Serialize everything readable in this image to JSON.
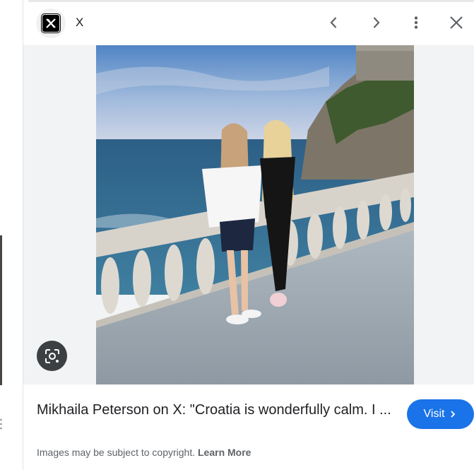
{
  "source": {
    "name": "X",
    "logo_letter": "X"
  },
  "icons": {
    "prev": "chevron-left-icon",
    "next": "chevron-right-icon",
    "more": "more-vert-icon",
    "close": "close-icon",
    "lens": "google-lens-icon"
  },
  "result": {
    "title": "Mikhaila Peterson on X: \"Croatia is wonderfully calm. I ...",
    "visit_label": "Visit"
  },
  "footer": {
    "copyright_text": "Images may be subject to copyright.",
    "learn_more": "Learn More"
  },
  "colors": {
    "accent": "#1a73e8",
    "text": "#202124",
    "muted": "#5f6368"
  }
}
